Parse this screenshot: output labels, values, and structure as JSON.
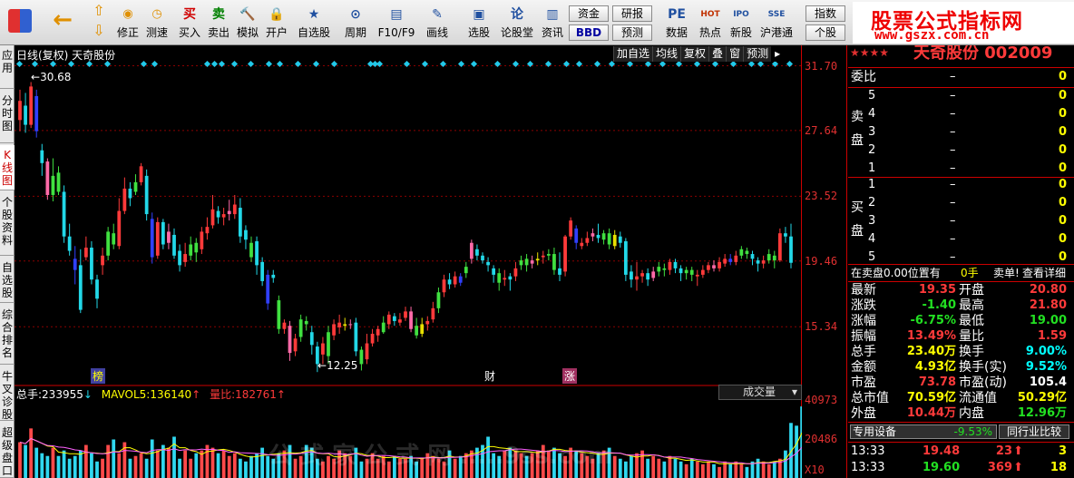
{
  "toolbar": {
    "items": [
      {
        "label": "买入",
        "icon": "买",
        "name": "buy-button",
        "color": "#d00000"
      },
      {
        "label": "卖出",
        "icon": "卖",
        "name": "sell-button",
        "color": "#008000"
      },
      {
        "label": "模拟",
        "icon": "🔨",
        "name": "simulate-button",
        "color": "#804000"
      },
      {
        "label": "开户",
        "icon": "🔒",
        "name": "open-account-button",
        "color": "#606060"
      },
      {
        "label": "自选股",
        "icon": "★",
        "name": "watchlist-button",
        "color": "#2050a0"
      },
      {
        "label": "周期",
        "icon": "⊙",
        "name": "period-button",
        "color": "#2050a0"
      },
      {
        "label": "F10/F9",
        "icon": "▤",
        "name": "f10-button",
        "color": "#2050a0"
      },
      {
        "label": "画线",
        "icon": "✎",
        "name": "draw-line-button",
        "color": "#2050a0"
      },
      {
        "label": "选股",
        "icon": "▣",
        "name": "stock-select-button",
        "color": "#2050a0"
      },
      {
        "label": "论股堂",
        "icon": "论",
        "name": "forum-button",
        "color": "#2050a0"
      },
      {
        "label": "资讯",
        "icon": "▥",
        "name": "news-button",
        "color": "#2050a0"
      },
      {
        "label": "数据",
        "icon": "PE",
        "name": "data-button",
        "color": "#2050a0"
      },
      {
        "label": "热点",
        "icon": "HOT",
        "name": "hot-button",
        "color": "#c03000"
      },
      {
        "label": "新股",
        "icon": "IPO",
        "name": "ipo-button",
        "color": "#2050a0"
      },
      {
        "label": "沪港通",
        "icon": "SSE",
        "name": "hk-connect-button",
        "color": "#2050a0"
      }
    ],
    "nav": {
      "back": "←",
      "up": "⇧",
      "down": "⇩",
      "fix_label": "修正",
      "test_label": "测速"
    },
    "small_buttons": {
      "fund": "资金",
      "research": "研报",
      "bbd": "BBD",
      "forecast": "预测",
      "index": "指数",
      "full": "全",
      "individual": "个股",
      "board": "板"
    }
  },
  "logo": {
    "line1": "股票公式指标网",
    "line2": "www.gszx.com.cn"
  },
  "side_tabs": [
    "应用",
    "分时图",
    "K线图",
    "个股资料",
    "自选股",
    "综合排名",
    "牛叉诊股",
    "超级盘口"
  ],
  "chart": {
    "title": "日线(复权)  天奇股份",
    "menu": [
      "加自选",
      "均线",
      "复权",
      "叠",
      "窗",
      "预测"
    ],
    "max_marker": "30.68",
    "min_marker": "12.25",
    "event_tags": [
      "榜",
      "财",
      "涨"
    ],
    "vol_header": {
      "total_label": "总手:",
      "total": "233955",
      "mavol_label": "MAVOL5:",
      "mavol": "136140",
      "ratio_label": "量比:",
      "ratio": "182761"
    },
    "vol_selector": "成交量",
    "watermark": "公  式  家  公  式  网  .....9ss.com"
  },
  "price_axis": [
    "31.70",
    "27.64",
    "23.52",
    "19.46",
    "15.34"
  ],
  "vol_axis": [
    "40973",
    "20486",
    "X10"
  ],
  "chart_data": {
    "type": "candlestick",
    "title": "日线(复权)  天奇股份",
    "ylim": [
      12.0,
      31.9
    ],
    "candles": [
      [
        28.3,
        29.5,
        27.6,
        30.2
      ],
      [
        29.2,
        28.0,
        27.5,
        30.0
      ],
      [
        28.0,
        30.4,
        27.8,
        30.68
      ],
      [
        29.8,
        27.6,
        27.2,
        30.2
      ],
      [
        26.4,
        25.6,
        24.8,
        26.8
      ],
      [
        25.7,
        23.6,
        23.3,
        25.9
      ],
      [
        23.6,
        24.8,
        23.2,
        25.9
      ],
      [
        25.0,
        23.8,
        23.6,
        25.4
      ],
      [
        23.8,
        21.0,
        20.6,
        24.2
      ],
      [
        21.0,
        20.1,
        19.8,
        21.8
      ],
      [
        19.6,
        18.9,
        18.0,
        20.4
      ],
      [
        19.2,
        16.4,
        16.2,
        20.2
      ],
      [
        19.7,
        20.3,
        19.5,
        21.0
      ],
      [
        20.3,
        18.3,
        18.0,
        20.7
      ],
      [
        18.3,
        17.1,
        16.5,
        18.6
      ],
      [
        19.2,
        19.8,
        18.6,
        20.3
      ],
      [
        19.8,
        21.3,
        19.5,
        21.6
      ],
      [
        21.2,
        20.5,
        20.2,
        21.8
      ],
      [
        20.4,
        22.6,
        20.2,
        23.4
      ],
      [
        22.6,
        24.0,
        22.4,
        24.7
      ],
      [
        24.0,
        23.4,
        22.9,
        24.4
      ],
      [
        23.8,
        24.4,
        23.6,
        24.9
      ],
      [
        24.4,
        25.4,
        24.2,
        25.6
      ],
      [
        24.8,
        22.4,
        22.0,
        25.2
      ],
      [
        22.1,
        19.7,
        19.3,
        22.5
      ],
      [
        19.8,
        21.9,
        19.6,
        22.2
      ],
      [
        21.9,
        20.5,
        20.2,
        22.1
      ],
      [
        20.6,
        21.3,
        20.2,
        21.8
      ],
      [
        21.1,
        19.8,
        19.6,
        21.5
      ],
      [
        20.1,
        19.2,
        18.8,
        20.5
      ],
      [
        19.4,
        19.9,
        19.1,
        20.6
      ],
      [
        19.8,
        20.5,
        19.5,
        21.0
      ],
      [
        20.6,
        20.0,
        19.4,
        20.9
      ],
      [
        20.2,
        21.3,
        19.9,
        21.6
      ],
      [
        21.2,
        21.6,
        20.8,
        22.2
      ],
      [
        21.7,
        22.7,
        21.5,
        23.6
      ],
      [
        22.6,
        22.2,
        21.8,
        22.9
      ],
      [
        22.2,
        22.4,
        21.7,
        22.8
      ],
      [
        22.4,
        22.6,
        22.0,
        23.3
      ],
      [
        22.4,
        23.0,
        22.1,
        23.6
      ],
      [
        22.8,
        21.0,
        20.6,
        23.4
      ],
      [
        21.4,
        20.8,
        20.2,
        21.7
      ],
      [
        20.6,
        19.7,
        19.4,
        21.0
      ],
      [
        20.7,
        19.2,
        18.6,
        21.0
      ],
      [
        19.4,
        18.2,
        17.9,
        19.7
      ],
      [
        18.6,
        16.8,
        16.4,
        18.9
      ],
      [
        18.6,
        18.4,
        18.1,
        18.9
      ],
      [
        17.0,
        15.2,
        14.9,
        17.3
      ],
      [
        15.2,
        15.6,
        14.9,
        15.8
      ],
      [
        15.4,
        13.7,
        13.2,
        15.7
      ],
      [
        13.8,
        14.6,
        13.5,
        14.9
      ],
      [
        14.7,
        15.8,
        14.4,
        16.1
      ],
      [
        15.7,
        15.5,
        15.1,
        16.0
      ],
      [
        15.0,
        14.2,
        13.6,
        15.4
      ],
      [
        14.1,
        13.0,
        12.5,
        14.4
      ],
      [
        13.6,
        14.3,
        13.0,
        14.7
      ],
      [
        13.5,
        15.0,
        13.0,
        15.4
      ],
      [
        14.8,
        15.5,
        14.5,
        15.8
      ],
      [
        15.3,
        15.6,
        14.9,
        16.1
      ],
      [
        15.4,
        15.5,
        15.1,
        15.9
      ],
      [
        15.5,
        15.5,
        15.2,
        15.8
      ],
      [
        15.6,
        13.8,
        13.5,
        15.9
      ],
      [
        13.9,
        13.0,
        12.6,
        14.1
      ],
      [
        13.3,
        14.3,
        13.0,
        14.9
      ],
      [
        14.3,
        14.9,
        14.1,
        15.2
      ],
      [
        14.8,
        15.2,
        14.4,
        15.4
      ],
      [
        15.0,
        15.6,
        14.9,
        16.0
      ],
      [
        15.5,
        16.1,
        15.2,
        16.3
      ],
      [
        16.0,
        15.7,
        15.4,
        16.2
      ],
      [
        15.6,
        15.8,
        15.4,
        16.2
      ],
      [
        15.9,
        16.3,
        15.7,
        16.6
      ],
      [
        16.3,
        15.2,
        15.0,
        16.6
      ],
      [
        15.4,
        14.8,
        14.6,
        15.9
      ],
      [
        14.9,
        15.5,
        14.7,
        15.9
      ],
      [
        15.5,
        15.7,
        15.1,
        16.0
      ],
      [
        15.8,
        16.5,
        15.6,
        16.9
      ],
      [
        16.5,
        17.5,
        16.2,
        17.8
      ],
      [
        17.5,
        18.3,
        17.2,
        18.6
      ],
      [
        18.3,
        18.0,
        17.7,
        18.7
      ],
      [
        18.0,
        18.5,
        17.8,
        18.8
      ],
      [
        18.5,
        18.1,
        17.9,
        18.7
      ],
      [
        18.7,
        19.1,
        18.4,
        19.4
      ],
      [
        19.6,
        20.6,
        19.3,
        20.8
      ],
      [
        20.2,
        19.8,
        19.5,
        20.5
      ],
      [
        19.8,
        19.5,
        19.3,
        20.0
      ],
      [
        19.4,
        19.2,
        18.8,
        19.7
      ],
      [
        19.0,
        18.6,
        18.1,
        19.2
      ],
      [
        18.7,
        18.1,
        17.6,
        19.0
      ],
      [
        18.3,
        18.4,
        17.9,
        18.9
      ],
      [
        18.5,
        18.3,
        17.6,
        18.7
      ],
      [
        18.5,
        19.0,
        18.2,
        19.4
      ],
      [
        19.2,
        19.5,
        18.9,
        19.8
      ],
      [
        19.6,
        19.2,
        18.8,
        19.9
      ],
      [
        19.3,
        19.5,
        19.0,
        19.8
      ],
      [
        19.5,
        19.6,
        19.2,
        20.0
      ],
      [
        19.7,
        19.8,
        19.3,
        20.1
      ],
      [
        19.8,
        19.9,
        19.5,
        20.2
      ],
      [
        19.9,
        18.9,
        18.6,
        20.3
      ],
      [
        19.0,
        18.6,
        18.2,
        20.0
      ],
      [
        18.8,
        21.0,
        18.5,
        21.1
      ],
      [
        21.0,
        22.0,
        20.8,
        22.2
      ],
      [
        21.5,
        20.6,
        20.2,
        21.7
      ],
      [
        20.4,
        20.6,
        20.2,
        20.9
      ],
      [
        20.6,
        20.9,
        20.4,
        21.3
      ],
      [
        21.0,
        21.2,
        20.7,
        21.5
      ],
      [
        21.1,
        20.9,
        20.6,
        21.8
      ],
      [
        20.8,
        21.2,
        20.5,
        21.4
      ],
      [
        21.2,
        20.5,
        20.2,
        21.5
      ],
      [
        20.4,
        21.1,
        20.2,
        21.4
      ],
      [
        21.0,
        20.6,
        20.3,
        21.3
      ],
      [
        20.7,
        18.6,
        18.2,
        20.9
      ],
      [
        18.8,
        18.3,
        17.8,
        19.2
      ],
      [
        18.3,
        18.5,
        17.6,
        19.4
      ],
      [
        18.5,
        18.7,
        18.1,
        18.9
      ],
      [
        18.7,
        18.3,
        17.9,
        19.0
      ],
      [
        18.4,
        18.8,
        18.2,
        19.1
      ],
      [
        18.8,
        19.1,
        18.5,
        19.4
      ],
      [
        19.0,
        18.9,
        18.5,
        19.3
      ],
      [
        18.9,
        19.4,
        18.6,
        19.6
      ],
      [
        19.4,
        19.0,
        18.7,
        19.6
      ],
      [
        19.0,
        18.7,
        18.2,
        19.2
      ],
      [
        18.7,
        18.9,
        18.3,
        19.1
      ],
      [
        18.9,
        18.6,
        18.2,
        19.1
      ],
      [
        18.5,
        18.6,
        17.9,
        18.9
      ],
      [
        18.6,
        18.9,
        18.4,
        19.2
      ],
      [
        18.9,
        19.2,
        18.7,
        19.4
      ],
      [
        19.2,
        19.0,
        18.8,
        19.5
      ],
      [
        19.0,
        19.4,
        18.8,
        19.7
      ],
      [
        19.3,
        19.6,
        19.1,
        19.9
      ],
      [
        19.6,
        19.4,
        19.2,
        19.9
      ],
      [
        19.4,
        19.8,
        19.2,
        20.1
      ],
      [
        19.8,
        20.2,
        19.6,
        20.4
      ],
      [
        20.1,
        19.9,
        19.6,
        20.3
      ],
      [
        19.9,
        19.6,
        19.2,
        20.1
      ],
      [
        19.5,
        19.3,
        18.8,
        19.7
      ],
      [
        19.3,
        19.5,
        19.0,
        19.8
      ],
      [
        19.5,
        19.9,
        19.3,
        20.2
      ],
      [
        19.8,
        19.5,
        19.0,
        20.1
      ],
      [
        19.5,
        21.2,
        19.4,
        21.5
      ],
      [
        21.2,
        21.0,
        20.6,
        21.6
      ],
      [
        21.0,
        19.35,
        19.0,
        21.8
      ]
    ],
    "volumes": [
      26,
      24,
      36,
      22,
      18,
      16,
      22,
      16,
      20,
      14,
      16,
      20,
      24,
      18,
      12,
      14,
      24,
      28,
      18,
      26,
      14,
      16,
      18,
      14,
      28,
      20,
      24,
      22,
      30,
      14,
      20,
      14,
      18,
      20,
      24,
      22,
      18,
      20,
      16,
      18,
      14,
      12,
      16,
      18,
      22,
      16,
      14,
      18,
      20,
      24,
      14,
      16,
      24,
      22,
      14,
      12,
      16,
      14,
      20,
      18,
      16,
      22,
      12,
      14,
      18,
      14,
      16,
      12,
      16,
      14,
      14,
      16,
      12,
      14,
      18,
      16,
      14,
      12,
      20,
      14,
      16,
      18,
      20,
      22,
      24,
      30,
      18,
      16,
      20,
      22,
      20,
      18,
      16,
      18,
      20,
      24,
      20,
      22,
      18,
      16,
      22,
      20,
      18,
      16,
      14,
      18,
      20,
      22,
      16,
      14,
      12,
      16,
      18,
      20,
      14,
      16,
      14,
      12,
      16,
      14,
      12,
      10,
      14,
      12,
      10,
      12,
      10,
      8,
      12,
      10,
      12,
      10,
      8,
      12,
      14,
      12,
      10,
      12,
      14,
      20,
      40,
      38,
      52,
      36
    ]
  },
  "quote": {
    "name": "天奇股份  002009",
    "weibi_label": "委比",
    "weibi_val": "–",
    "weibi_num": "0",
    "sell_label": "卖盘",
    "buy_label": "买盘",
    "sell": [
      [
        "5",
        "–",
        "0"
      ],
      [
        "4",
        "–",
        "0"
      ],
      [
        "3",
        "–",
        "0"
      ],
      [
        "2",
        "–",
        "0"
      ],
      [
        "1",
        "–",
        "0"
      ]
    ],
    "buy": [
      [
        "1",
        "–",
        "0"
      ],
      [
        "2",
        "–",
        "0"
      ],
      [
        "3",
        "–",
        "0"
      ],
      [
        "4",
        "–",
        "0"
      ],
      [
        "5",
        "–",
        "0"
      ]
    ],
    "status": "在卖盘0.00位置有",
    "status_val": "0手",
    "single": "卖单!",
    "detail": "查看详细",
    "rows": [
      [
        "最新",
        "19.35",
        "开盘",
        "20.80"
      ],
      [
        "涨跌",
        "-1.40",
        "最高",
        "21.80"
      ],
      [
        "涨幅",
        "-6.75%",
        "最低",
        "19.00"
      ],
      [
        "振幅",
        "13.49%",
        "量比",
        "1.59"
      ],
      [
        "总手",
        "23.40万",
        "换手",
        "9.00%"
      ],
      [
        "金额",
        "4.93亿",
        "换手(实)",
        "9.52%"
      ],
      [
        "市盈",
        "73.78",
        "市盈(动)",
        "105.4"
      ],
      [
        "总市值",
        "70.59亿",
        "流通值",
        "50.29亿"
      ],
      [
        "外盘",
        "10.44万",
        "内盘",
        "12.96万"
      ]
    ],
    "tab1": "专用设备",
    "tab1_val": "-9.53%",
    "tab2": "同行业比较",
    "ticks": [
      [
        "13:33",
        "19.48",
        "23",
        "3"
      ],
      [
        "13:33",
        "19.60",
        "369",
        "18"
      ]
    ]
  },
  "colors": {
    "up": "#ff3a3a",
    "down": "#22d8e8",
    "grid": "#8b0000"
  }
}
